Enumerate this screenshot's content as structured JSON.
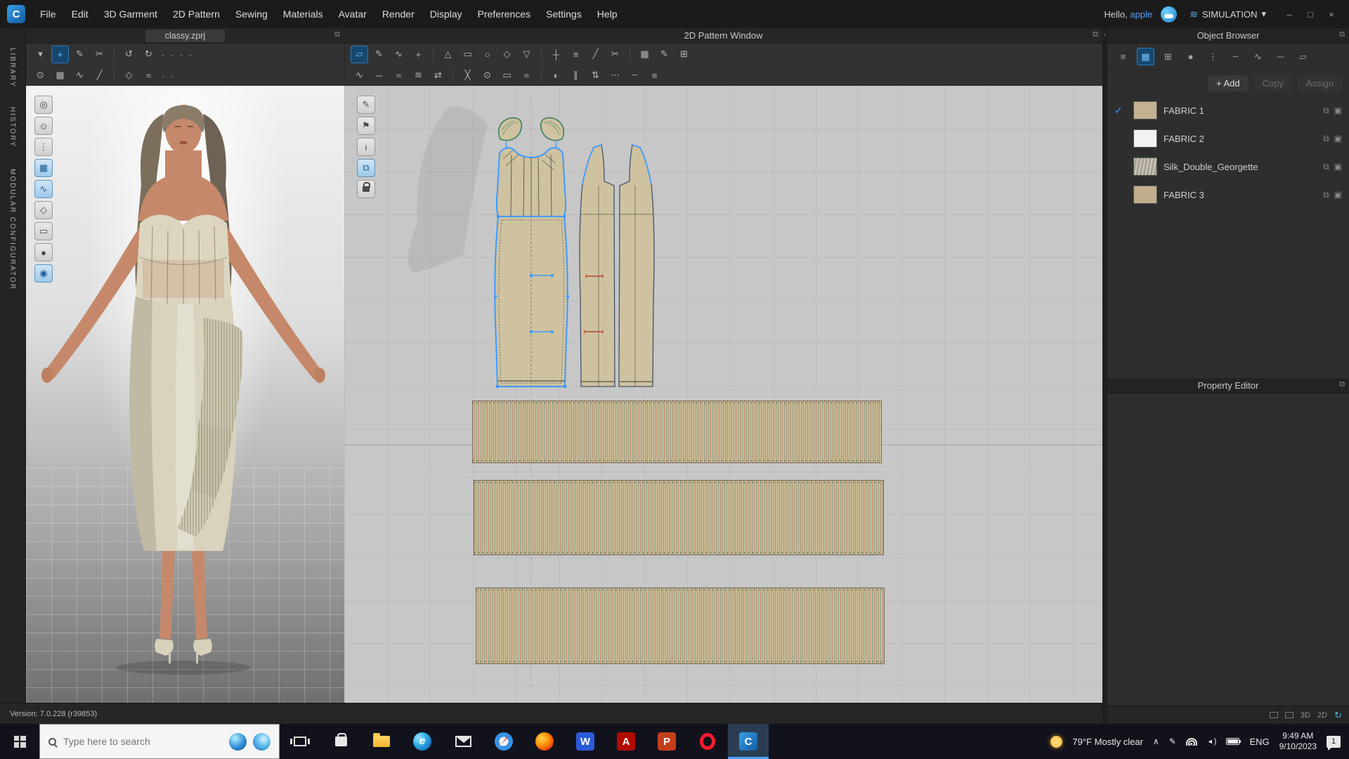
{
  "app": {
    "logo_letter": "C",
    "menu": [
      "File",
      "Edit",
      "3D Garment",
      "2D Pattern",
      "Sewing",
      "Materials",
      "Avatar",
      "Render",
      "Display",
      "Preferences",
      "Settings",
      "Help"
    ],
    "hello_prefix": "Hello,",
    "user_name": "apple",
    "simulation_label": "SIMULATION"
  },
  "icons": {
    "minimize": "–",
    "maximize": "□",
    "close": "×",
    "dropdown": "▾",
    "check": "✓",
    "popout": "⧉",
    "expand": "›",
    "chevron_up": "∧",
    "simulation": "≋",
    "sync": "↻"
  },
  "left_rail": [
    "LIBRARY",
    "HISTORY",
    "MODULAR CONFIGURATOR"
  ],
  "viewport3d": {
    "tab_title": "classy.zprj",
    "version": "Version: 7.0.228 (r39853)"
  },
  "pattern2d": {
    "title": "2D Pattern Window"
  },
  "object_browser": {
    "title": "Object Browser",
    "add_label": "+ Add",
    "copy_label": "Copy",
    "assign_label": "Assign",
    "fabrics": [
      {
        "name": "FABRIC 1"
      },
      {
        "name": "FABRIC 2"
      },
      {
        "name": "Silk_Double_Georgette"
      },
      {
        "name": "FABRIC 3"
      }
    ]
  },
  "property_editor": {
    "title": "Property Editor"
  },
  "status": {
    "toggle_3d": "3D",
    "toggle_2d": "2D"
  },
  "taskbar": {
    "search_placeholder": "Type here to search",
    "weather_text": "79°F Mostly clear",
    "language": "ENG",
    "time": "9:49 AM",
    "date": "9/10/2023",
    "notification_count": "1",
    "app_letters": {
      "edge": "e",
      "word": "W",
      "acrobat": "A",
      "powerpoint": "P",
      "clo": "C"
    }
  }
}
